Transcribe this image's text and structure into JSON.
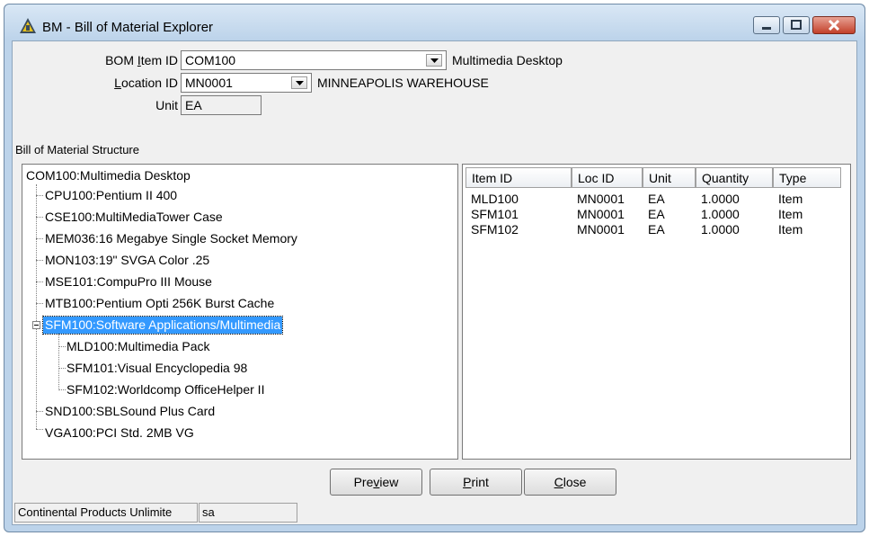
{
  "window": {
    "title": "BM - Bill of Material Explorer"
  },
  "form": {
    "bom_item_label_pre": "BOM ",
    "bom_item_label_ul": "I",
    "bom_item_label_post": "tem ID",
    "bom_item_value": "COM100",
    "bom_item_desc": "Multimedia Desktop",
    "location_label_ul": "L",
    "location_label_post": "ocation ID",
    "location_value": "MN0001",
    "location_desc": "MINNEAPOLIS WAREHOUSE",
    "unit_label": "Unit",
    "unit_value": "EA"
  },
  "tree": {
    "section_label": "Bill of Material Structure",
    "root": "COM100:Multimedia Desktop",
    "nodes": [
      "CPU100:Pentium II 400",
      "CSE100:MultiMediaTower Case",
      "MEM036:16 Megabye Single Socket Memory",
      "MON103:19\" SVGA Color .25",
      "MSE101:CompuPro III Mouse",
      "MTB100:Pentium Opti 256K Burst Cache",
      "SFM100:Software Applications/Multimedia",
      "MLD100:Multimedia Pack",
      "SFM101:Visual Encyclopedia 98",
      "SFM102:Worldcomp OfficeHelper II",
      "SND100:SBLSound Plus Card",
      "VGA100:PCI Std. 2MB VG"
    ]
  },
  "table": {
    "columns": [
      "Item ID",
      "Loc ID",
      "Unit",
      "Quantity",
      "Type"
    ],
    "rows": [
      [
        "MLD100",
        "MN0001",
        "EA",
        "1.0000",
        "Item"
      ],
      [
        "SFM101",
        "MN0001",
        "EA",
        "1.0000",
        "Item"
      ],
      [
        "SFM102",
        "MN0001",
        "EA",
        "1.0000",
        "Item"
      ]
    ]
  },
  "buttons": {
    "preview_pre": "Pre",
    "preview_ul": "v",
    "preview_post": "iew",
    "print_ul": "P",
    "print_post": "rint",
    "close_ul": "C",
    "close_post": "lose"
  },
  "status": {
    "company": "Continental Products Unlimite",
    "user": "sa"
  },
  "colors": {
    "selection": "#3399ff",
    "frame": "#bcd3ea",
    "close_button": "#c2402a"
  }
}
